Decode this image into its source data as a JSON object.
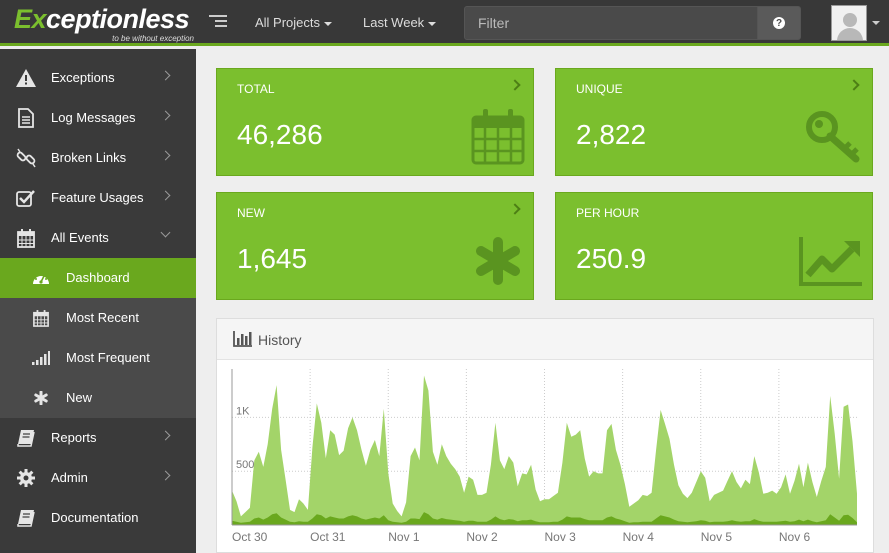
{
  "header": {
    "logo_main_ex": "Ex",
    "logo_main_rest": "ceptionless",
    "logo_tagline": "to be without exception",
    "project_dropdown": "All Projects",
    "time_dropdown": "Last Week",
    "filter_placeholder": "Filter",
    "help_symbol": "?"
  },
  "sidebar": {
    "items": [
      {
        "label": "Exceptions",
        "icon": "warning-icon"
      },
      {
        "label": "Log Messages",
        "icon": "document-icon"
      },
      {
        "label": "Broken Links",
        "icon": "broken-link-icon"
      },
      {
        "label": "Feature Usages",
        "icon": "checkbox-icon"
      },
      {
        "label": "All Events",
        "icon": "calendar-icon"
      },
      {
        "label": "Dashboard",
        "icon": "dashboard-icon"
      },
      {
        "label": "Most Recent",
        "icon": "calendar-icon"
      },
      {
        "label": "Most Frequent",
        "icon": "signal-icon"
      },
      {
        "label": "New",
        "icon": "asterisk-icon"
      },
      {
        "label": "Reports",
        "icon": "book-icon"
      },
      {
        "label": "Admin",
        "icon": "gear-icon"
      },
      {
        "label": "Documentation",
        "icon": "book-icon"
      }
    ]
  },
  "stats": {
    "total": {
      "title": "TOTAL",
      "value": "46,286"
    },
    "unique": {
      "title": "UNIQUE",
      "value": "2,822"
    },
    "new": {
      "title": "NEW",
      "value": "1,645"
    },
    "per_hour": {
      "title": "PER HOUR",
      "value": "250.9"
    }
  },
  "history": {
    "title": "History"
  },
  "colors": {
    "accent": "#7bbf2e",
    "accent_dark": "#6aa81e",
    "header_bg": "#383838",
    "sidebar_bg": "#3a3a3a"
  },
  "chart_data": {
    "type": "area",
    "title": "History",
    "xlabel": "",
    "ylabel": "",
    "x": [
      "Oct 30",
      "Oct 31",
      "Nov 1",
      "Nov 2",
      "Nov 3",
      "Nov 4",
      "Nov 5",
      "Nov 6"
    ],
    "ylim": [
      0,
      1450
    ],
    "y_ticks": [
      {
        "value": 500,
        "label": "500"
      },
      {
        "value": 1000,
        "label": "1K"
      }
    ],
    "grid": true,
    "series": [
      {
        "name": "",
        "color": "#a3d469",
        "values": [
          320,
          220,
          80,
          120,
          160,
          600,
          680,
          540,
          750,
          1080,
          1300,
          700,
          420,
          140,
          120,
          240,
          200,
          140,
          720,
          1130,
          950,
          620,
          880,
          840,
          650,
          690,
          900,
          1000,
          880,
          700,
          550,
          700,
          790,
          640,
          1080,
          480,
          200,
          130,
          80,
          210,
          640,
          720,
          600,
          1390,
          1250,
          680,
          560,
          750,
          640,
          570,
          520,
          450,
          300,
          450,
          420,
          280,
          280,
          300,
          560,
          950,
          600,
          520,
          640,
          580,
          360,
          480,
          470,
          560,
          330,
          220,
          240,
          240,
          270,
          300,
          580,
          950,
          820,
          840,
          880,
          620,
          450,
          500,
          480,
          480,
          880,
          940,
          700,
          560,
          380,
          170,
          200,
          230,
          280,
          270,
          300,
          700,
          1070,
          940,
          800,
          560,
          370,
          290,
          250,
          300,
          400,
          500,
          440,
          220,
          280,
          300,
          320,
          410,
          500,
          400,
          340,
          420,
          380,
          640,
          490,
          290,
          300,
          320,
          290,
          350,
          470,
          290,
          410,
          570,
          350,
          580,
          400,
          260,
          410,
          540,
          1200,
          850,
          430,
          1100,
          1120,
          780,
          290
        ]
      },
      {
        "name": "",
        "color": "#6aa81e",
        "values": [
          40,
          30,
          20,
          25,
          30,
          60,
          70,
          50,
          70,
          100,
          110,
          70,
          50,
          30,
          25,
          35,
          30,
          30,
          60,
          100,
          90,
          60,
          80,
          70,
          60,
          60,
          80,
          90,
          80,
          60,
          50,
          60,
          70,
          60,
          90,
          45,
          30,
          25,
          20,
          30,
          60,
          60,
          55,
          120,
          100,
          60,
          50,
          65,
          55,
          50,
          45,
          40,
          30,
          40,
          40,
          30,
          30,
          30,
          50,
          80,
          55,
          45,
          55,
          50,
          35,
          45,
          45,
          50,
          35,
          25,
          25,
          25,
          30,
          30,
          50,
          80,
          70,
          70,
          70,
          55,
          45,
          45,
          45,
          45,
          70,
          80,
          60,
          50,
          35,
          20,
          25,
          25,
          30,
          30,
          30,
          60,
          90,
          80,
          70,
          50,
          35,
          30,
          25,
          30,
          35,
          45,
          40,
          25,
          30,
          30,
          30,
          35,
          45,
          35,
          30,
          35,
          35,
          55,
          40,
          30,
          30,
          30,
          30,
          35,
          40,
          30,
          35,
          50,
          35,
          50,
          35,
          25,
          35,
          45,
          100,
          70,
          40,
          90,
          95,
          65,
          25
        ]
      }
    ]
  }
}
